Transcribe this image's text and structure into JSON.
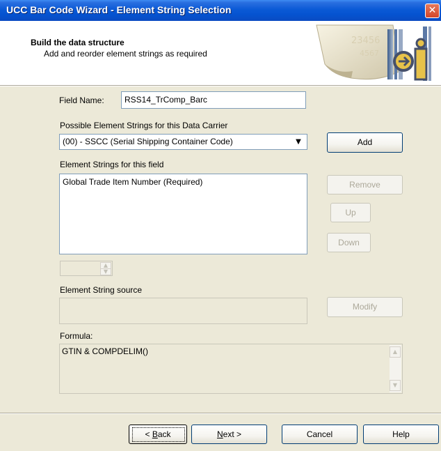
{
  "window": {
    "title": "UCC Bar Code Wizard - Element String Selection"
  },
  "header": {
    "title": "Build the data structure",
    "subtitle": "Add and reorder element strings as required"
  },
  "field_name": {
    "label": "Field Name:",
    "value": "RSS14_TrComp_Barc"
  },
  "possible_strings": {
    "label": "Possible Element Strings for this Data Carrier",
    "selected": "(00) - SSCC (Serial Shipping Container Code)"
  },
  "buttons": {
    "add": "Add",
    "remove": "Remove",
    "up": "Up",
    "down": "Down",
    "modify": "Modify",
    "back_prefix": "< ",
    "back_underline": "B",
    "back_rest": "ack",
    "next_underline": "N",
    "next_rest": "ext >",
    "cancel": "Cancel",
    "help": "Help"
  },
  "element_strings": {
    "label": "Element Strings for this field",
    "items": [
      "Global Trade Item Number (Required)"
    ]
  },
  "source": {
    "label": "Element String source",
    "value": ""
  },
  "formula": {
    "label": "Formula:",
    "value": "GTIN & COMPDELIM()"
  },
  "icons": [
    "close-icon",
    "wizard-logo-icon",
    "dropdown-arrow-icon",
    "spinner-up-icon",
    "spinner-down-icon",
    "scroll-up-icon",
    "scroll-down-icon"
  ]
}
